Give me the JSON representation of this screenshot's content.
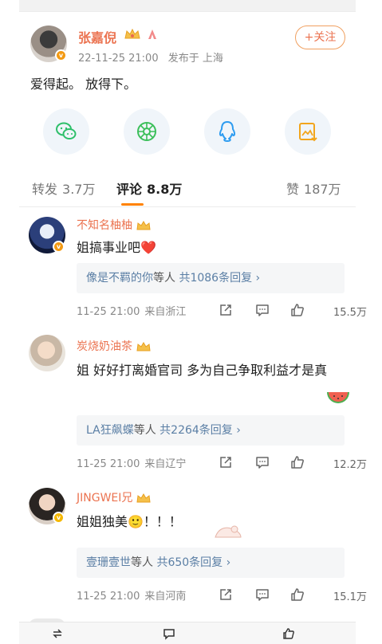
{
  "post": {
    "author": "张嘉倪",
    "date": "22-11-25 21:00",
    "location": "发布于 上海",
    "follow_label": "+关注",
    "text": "爱得起。 放得下。",
    "verified_mark": "v"
  },
  "share": {
    "icons": [
      "wechat-icon",
      "moments-icon",
      "qq-icon",
      "save-image-icon"
    ]
  },
  "tabs": {
    "repost_label": "转发",
    "repost_count": "3.7万",
    "comment_label": "评论",
    "comment_count": "8.8万",
    "like_label": "赞",
    "like_count": "187万"
  },
  "comments": [
    {
      "name": "不知名柚柚",
      "text": "姐搞事业吧❤️",
      "replies_who": "像是不羁的你",
      "replies_mid": "等人",
      "replies_total": "共1086条回复 ›",
      "time": "11-25 21:00",
      "from": "来自浙江",
      "likes": "15.5万"
    },
    {
      "name": "炭烧奶油茶",
      "text": "姐 好好打离婚官司 多为自己争取利益才是真",
      "replies_who": "LA狂飙蝶",
      "replies_mid": "等人",
      "replies_total": "共2264条回复 ›",
      "time": "11-25 21:00",
      "from": "来自辽宁",
      "likes": "12.2万"
    },
    {
      "name": "JINGWEI兄",
      "text": "姐姐独美🙂！！！",
      "replies_who": "壹珊壹世",
      "replies_mid": "等人",
      "replies_total": "共650条回复 ›",
      "time": "11-25 21:00",
      "from": "来自河南",
      "likes": "15.1万"
    }
  ],
  "colors": {
    "accent": "#eb7350",
    "link": "#5b7fa5",
    "tab_indicator": "#ff8200",
    "verified": "#f39a13"
  }
}
